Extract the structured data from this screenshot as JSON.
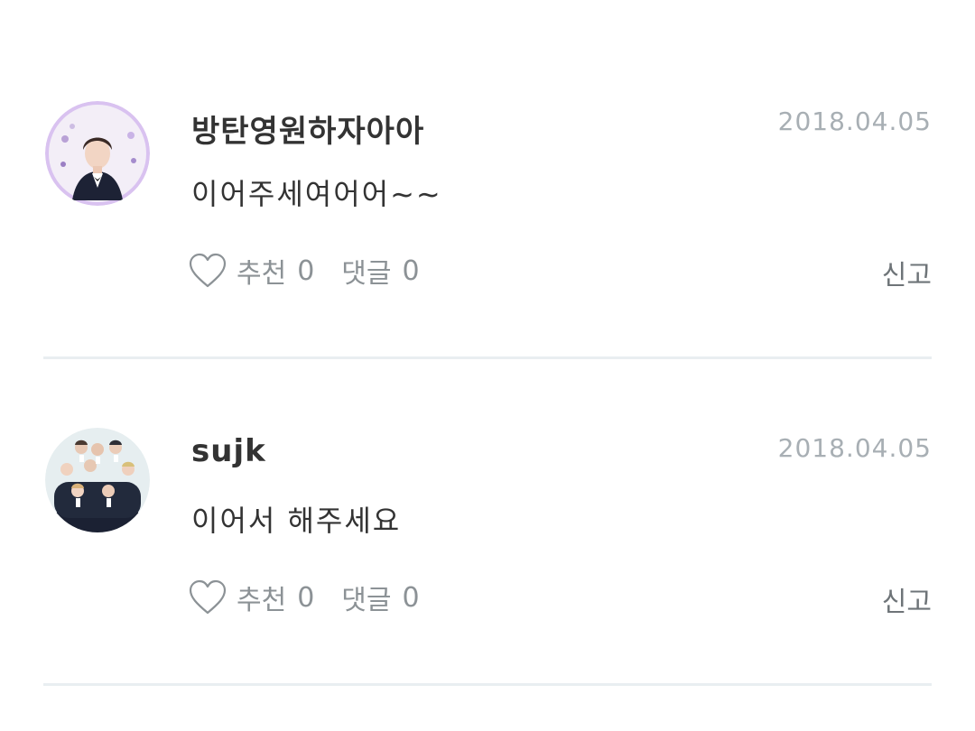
{
  "comments": [
    {
      "username": "방탄영원하자아아",
      "date": "2018.04.05",
      "text": "이어주세여어어~~",
      "like_label": "추천",
      "like_count": "0",
      "reply_label": "댓글",
      "reply_count": "0",
      "report_label": "신고",
      "avatar": "profile-photo-single"
    },
    {
      "username": "sujk",
      "date": "2018.04.05",
      "text": "이어서 해주세요",
      "like_label": "추천",
      "like_count": "0",
      "reply_label": "댓글",
      "reply_count": "0",
      "report_label": "신고",
      "avatar": "profile-photo-group"
    }
  ],
  "colors": {
    "date": "#a8afb4",
    "action": "#8c9296",
    "divider": "#e9eef1",
    "avatar_ring": "#d9c2f0"
  }
}
